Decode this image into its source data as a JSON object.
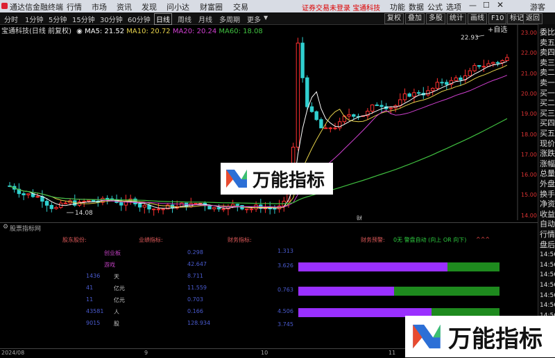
{
  "titlebar": {
    "app_title": "通达信金融终端",
    "menu": [
      "行情",
      "市场",
      "资讯",
      "发现",
      "问小达",
      "财富圈",
      "交易"
    ],
    "status": "证券交易未登录",
    "stock_name_red": "宝通科技",
    "right_menu": [
      "功能",
      "数据",
      "公式",
      "选项"
    ],
    "guest": "游客"
  },
  "periods": [
    "分时",
    "1分钟",
    "5分钟",
    "15分钟",
    "30分钟",
    "60分钟",
    "日线",
    "周线",
    "月线",
    "多周期",
    "更多"
  ],
  "active_period": "日线",
  "tools": [
    "复权",
    "叠加",
    "多股",
    "统计",
    "画线",
    "F10",
    "标记",
    "+自选",
    "返回"
  ],
  "legend": {
    "stock": "宝通科技(日线 前复权)",
    "ma5": "MA5: 21.52",
    "ma10": "MA10: 20.72",
    "ma20": "MA20: 20.24",
    "ma60": "MA60: 18.08"
  },
  "colors": {
    "up": "#ff3030",
    "down": "#30d0d0",
    "ma5": "#ffffff",
    "ma10": "#e6d24b",
    "ma20": "#d040d0",
    "ma60": "#40c040",
    "accent": "#9a30ff",
    "green_bar": "#1e8a1e"
  },
  "price_axis": [
    "23.00",
    "22.00",
    "21.00",
    "20.00",
    "19.00",
    "18.00",
    "17.00",
    "16.00",
    "15.00",
    "14.00"
  ],
  "high_label": "22.93",
  "low_label": "14.08",
  "cai_marker": "财",
  "right_panel": [
    "委比",
    "卖五",
    "卖四",
    "卖三",
    "卖二",
    "卖一",
    "买一",
    "买二",
    "买三",
    "买四",
    "买五",
    "现价",
    "涨跌",
    "涨幅",
    "总量",
    "外盘",
    "换手",
    "净资",
    "收益",
    "自动",
    "行情",
    "盘后",
    "14:56",
    "14:56",
    "14:56",
    "14:56",
    "14:56",
    "14:56",
    "14:56"
  ],
  "sub": {
    "title": "股票指标网",
    "shareholder_label": "股东股份:",
    "industry_label": "业绩指标:",
    "finance_label": "财务指标:",
    "forecast_label": "财务预警:",
    "forecast_detail": "0无 警盘自动 (向上 OR 向下)",
    "carets": "^^^",
    "left_items": [
      {
        "name": "创业板",
        "val": "0.298"
      },
      {
        "name": "游戏",
        "val": "42.647"
      },
      {
        "name": "天",
        "num": "1436",
        "val": "8.711"
      },
      {
        "name": "亿元",
        "num": "41",
        "val": "11.559"
      },
      {
        "name": "亿元",
        "num": "11",
        "val": "0.703"
      },
      {
        "name": "人",
        "num": "43581",
        "val": "0.166"
      },
      {
        "name": "股",
        "num": "9015",
        "val": "128.934"
      }
    ],
    "bar_values": [
      "1.313",
      "3.626",
      "0.763",
      "4.506",
      "3.745"
    ]
  },
  "dates": [
    "2024/08",
    "9",
    "10",
    "11"
  ],
  "watermark": "万能指标"
}
